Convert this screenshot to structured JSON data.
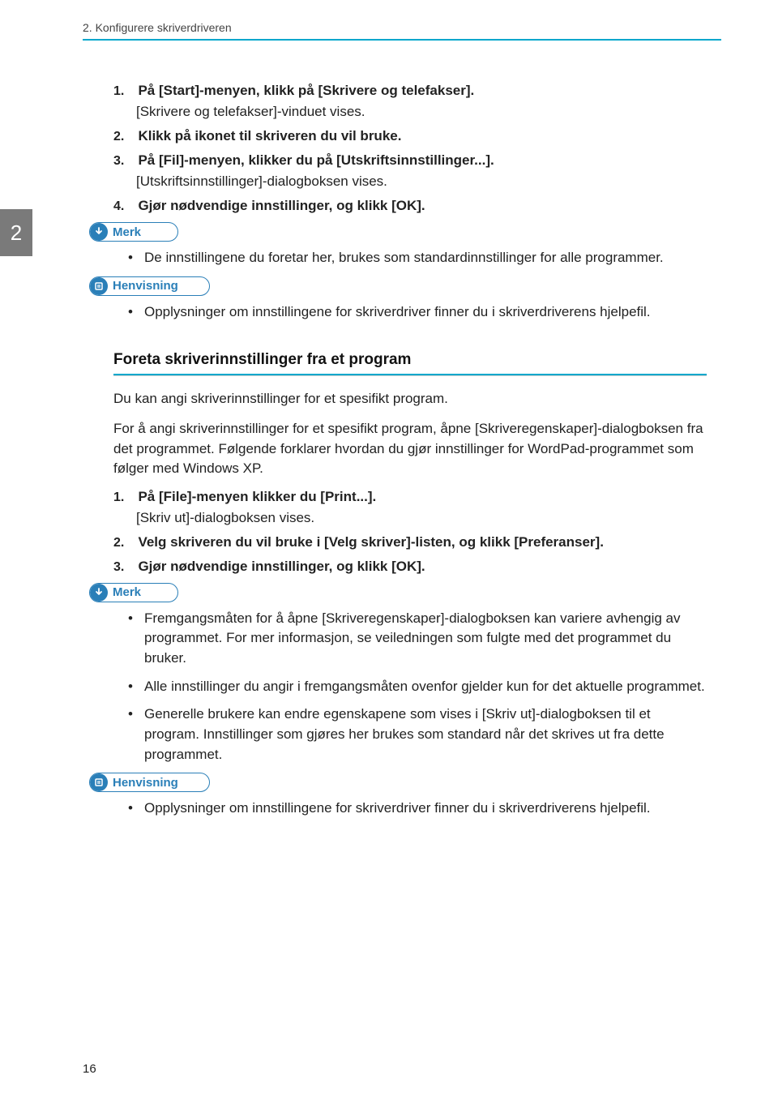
{
  "header": {
    "running_head": "2. Konfigurere skriverdriveren"
  },
  "sidebar": {
    "chapter_number": "2"
  },
  "section1": {
    "steps": [
      {
        "num": "1.",
        "text": "På [Start]-menyen, klikk på [Skrivere og telefakser].",
        "sub": "[Skrivere og telefakser]-vinduet vises."
      },
      {
        "num": "2.",
        "text": "Klikk på ikonet til skriveren du vil bruke.",
        "sub": ""
      },
      {
        "num": "3.",
        "text": "På [Fil]-menyen, klikker du på [Utskriftsinnstillinger...].",
        "sub": "[Utskriftsinnstillinger]-dialogboksen vises."
      },
      {
        "num": "4.",
        "text": "Gjør nødvendige innstillinger, og klikk [OK].",
        "sub": ""
      }
    ]
  },
  "callouts": {
    "merk_label": "Merk",
    "henvisning_label": "Henvisning"
  },
  "merk1_items": [
    "De innstillingene du foretar her, brukes som standardinnstillinger for alle programmer."
  ],
  "henv1_items": [
    "Opplysninger om innstillingene for skriverdriver finner du i skriverdriverens hjelpefil."
  ],
  "section2": {
    "title": "Foreta skriverinnstillinger fra et program",
    "intro1": "Du kan angi skriverinnstillinger for et spesifikt program.",
    "intro2": "For å angi skriverinnstillinger for et spesifikt program, åpne [Skriveregenskaper]-dialogboksen fra det programmet. Følgende forklarer hvordan du gjør innstillinger for WordPad-programmet som følger med Windows XP.",
    "steps": [
      {
        "num": "1.",
        "text": "På [File]-menyen klikker du [Print...].",
        "sub": "[Skriv ut]-dialogboksen vises."
      },
      {
        "num": "2.",
        "text": "Velg skriveren du vil bruke i [Velg skriver]-listen, og klikk [Preferanser].",
        "sub": ""
      },
      {
        "num": "3.",
        "text": "Gjør nødvendige innstillinger, og klikk [OK].",
        "sub": ""
      }
    ]
  },
  "merk2_items": [
    "Fremgangsmåten for å åpne [Skriveregenskaper]-dialogboksen kan variere avhengig av programmet. For mer informasjon, se veiledningen som fulgte med det programmet du bruker.",
    "Alle innstillinger du angir i fremgangsmåten ovenfor gjelder kun for det aktuelle programmet.",
    "Generelle brukere kan endre egenskapene som vises i [Skriv ut]-dialogboksen til et program. Innstillinger som gjøres her brukes som standard når det skrives ut fra dette programmet."
  ],
  "henv2_items": [
    "Opplysninger om innstillingene for skriverdriver finner du i skriverdriverens hjelpefil."
  ],
  "footer": {
    "page_number": "16"
  }
}
